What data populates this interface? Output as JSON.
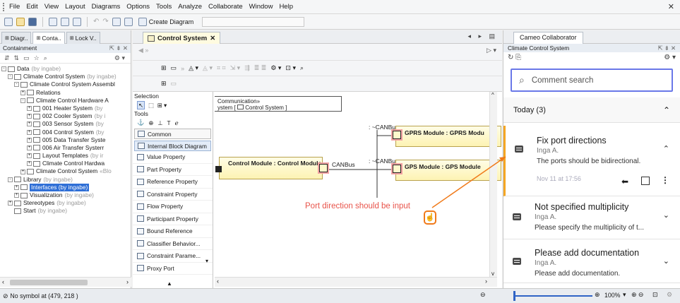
{
  "menu": [
    "File",
    "Edit",
    "View",
    "Layout",
    "Diagrams",
    "Options",
    "Tools",
    "Analyze",
    "Collaborate",
    "Window",
    "Help"
  ],
  "toolbar": {
    "create_diagram": "Create Diagram"
  },
  "left": {
    "tabs": [
      "Diagr..",
      "Conta..",
      "Lock V.."
    ],
    "header": "Containment",
    "tree": [
      {
        "indent": 0,
        "label": "Data",
        "suffix": "(by ingabe)",
        "expand": "-"
      },
      {
        "indent": 1,
        "label": "Climate Control System",
        "suffix": "(by ingabe)",
        "expand": "-"
      },
      {
        "indent": 2,
        "label": "Climate Control System Assembl",
        "suffix": "",
        "expand": "-"
      },
      {
        "indent": 3,
        "label": "Relations",
        "suffix": "",
        "expand": "+"
      },
      {
        "indent": 3,
        "label": "Climate Control Hardware A",
        "suffix": "",
        "expand": "-"
      },
      {
        "indent": 4,
        "label": "001 Heater System",
        "suffix": "(by",
        "expand": "+"
      },
      {
        "indent": 4,
        "label": "002 Cooler System",
        "suffix": "(by i",
        "expand": "+"
      },
      {
        "indent": 4,
        "label": "003 Sensor System",
        "suffix": "(by",
        "expand": "+"
      },
      {
        "indent": 4,
        "label": "004 Control System",
        "suffix": "(by",
        "expand": "+"
      },
      {
        "indent": 4,
        "label": "005 Data Transfer Syste",
        "suffix": "",
        "expand": "+"
      },
      {
        "indent": 4,
        "label": "006 Air Transfer Systerr",
        "suffix": "",
        "expand": "+"
      },
      {
        "indent": 4,
        "label": "Layout Templates",
        "suffix": "(by ir",
        "expand": "+"
      },
      {
        "indent": 4,
        "label": "Climate Control Hardwa",
        "suffix": "",
        "expand": "+"
      },
      {
        "indent": 3,
        "label": "Climate Control System",
        "suffix": "«Blo",
        "expand": "+"
      },
      {
        "indent": 1,
        "label": "Library",
        "suffix": "(by ingabe)",
        "expand": "-"
      },
      {
        "indent": 2,
        "label": "Interfaces (by ingabe)",
        "suffix": "",
        "expand": "+",
        "selected": true
      },
      {
        "indent": 2,
        "label": "Visualization",
        "suffix": "(by ingabe)",
        "expand": "+"
      },
      {
        "indent": 1,
        "label": "Stereotypes",
        "suffix": "(by ingabe)",
        "expand": "+"
      },
      {
        "indent": 1,
        "label": "Start",
        "suffix": "(by ingabe)",
        "expand": ""
      }
    ]
  },
  "center": {
    "tab": "Control System",
    "palette": {
      "selection": "Selection",
      "tools": "Tools",
      "common": "Common",
      "ibd": "Internal Block Diagram",
      "items": [
        "Value Property",
        "Part Property",
        "Reference Property",
        "Constraint Property",
        "Flow Property",
        "Participant Property",
        "Bound Reference",
        "Classifier Behavior...",
        "Constraint Parame...",
        "Proxy Port"
      ]
    },
    "frame": {
      "line1": "Communication»",
      "line2": "ystem [",
      "line3": "Control System ]"
    },
    "blocks": {
      "control": "Control Module : Control Module",
      "gprs": "GPRS Module : GPRS Modu",
      "gps": "GPS Module : GPS Module"
    },
    "labels": {
      "canbus_left": "CANBus",
      "canbus_top": ": ~CANBus",
      "canbus_mid": ": ~CANBus"
    },
    "annotation": "Port direction should be input"
  },
  "right": {
    "tab": "Cameo Collaborator",
    "header": "Climate Control System",
    "search_placeholder": "Comment search",
    "today": "Today (3)",
    "comments": [
      {
        "title": "Fix port directions",
        "user": "Inga A.",
        "body": "The ports should be bidirectional.",
        "time": "Nov 11 at 17:56"
      },
      {
        "title": "Not specified multiplicity",
        "user": "Inga A.",
        "body": "Please specify the multiplicity of t..."
      },
      {
        "title": "Please add documentation",
        "user": "Inga A.",
        "body": "Please add documentation."
      }
    ]
  },
  "status": {
    "text": "No symbol at (479, 218 )",
    "zoom": "100%"
  },
  "colors": {
    "accent": "#f5a623",
    "search_border": "#6a78e8",
    "annotation": "#e8534a",
    "selection": "#2f6fd6"
  }
}
